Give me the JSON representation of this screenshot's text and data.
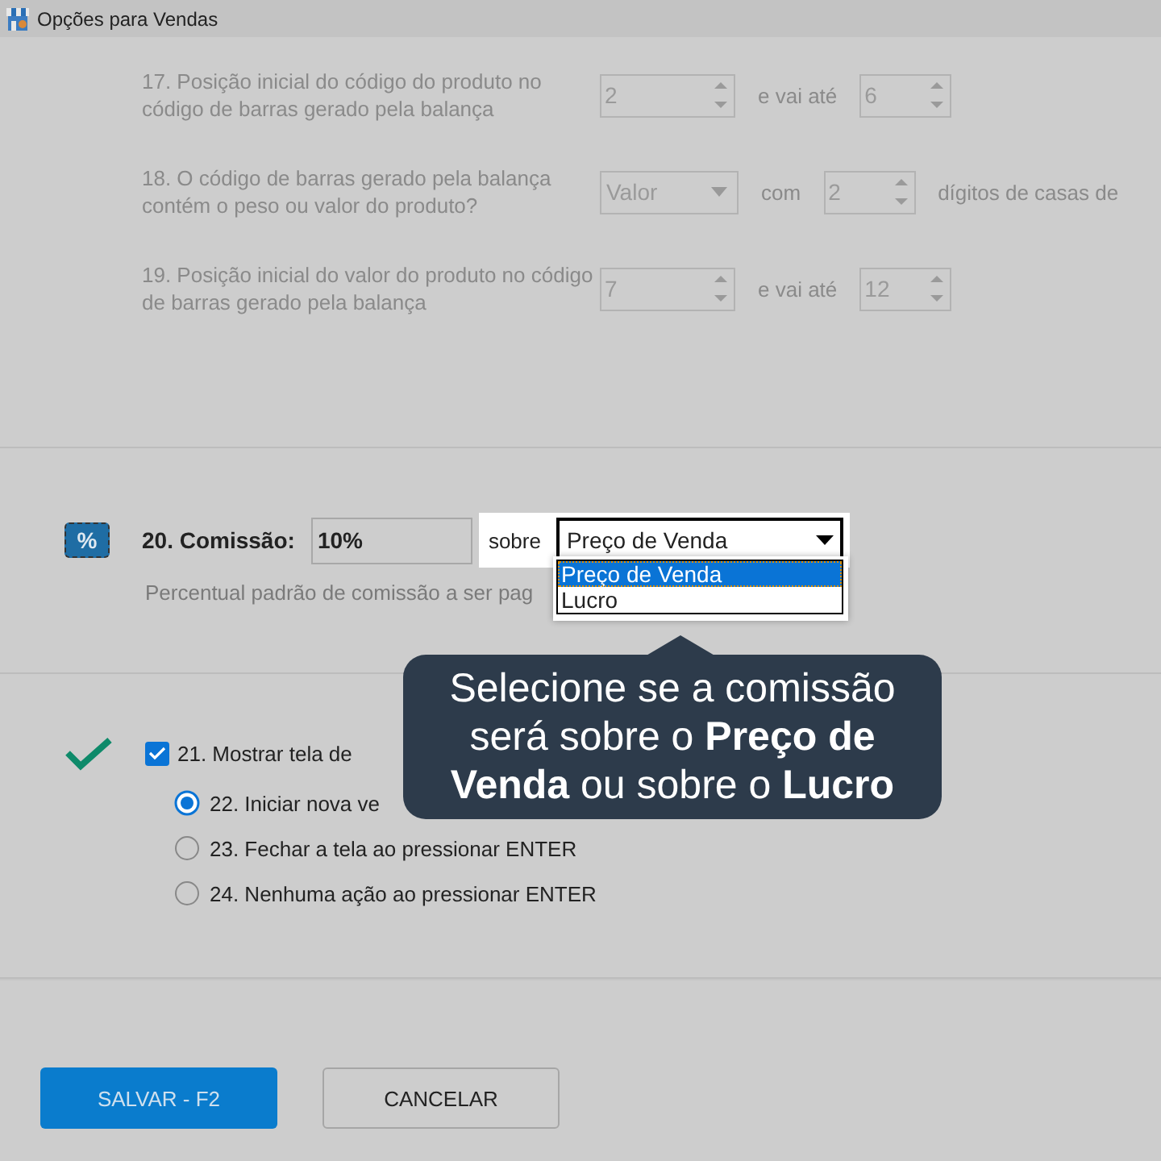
{
  "window": {
    "title": "Opções para Vendas"
  },
  "scale_rows": [
    {
      "label": "17. Posição inicial do código do produto no código de barras gerado pela balança",
      "fields": [
        {
          "kind": "spinner",
          "value": "2"
        },
        {
          "kind": "text",
          "text": "e vai até"
        },
        {
          "kind": "spinner",
          "value": "6"
        }
      ]
    },
    {
      "label": "18. O código de barras gerado pela balança contém o peso ou valor do produto?",
      "fields": [
        {
          "kind": "combo",
          "value": "Valor"
        },
        {
          "kind": "text",
          "text": "com"
        },
        {
          "kind": "spinner",
          "value": "2"
        },
        {
          "kind": "text",
          "text": "dígitos de casas de"
        }
      ]
    },
    {
      "label": "19. Posição inicial do valor do produto no código de barras gerado pela balança",
      "fields": [
        {
          "kind": "spinner",
          "value": "7"
        },
        {
          "kind": "text",
          "text": "e vai até"
        },
        {
          "kind": "spinner",
          "value": "12"
        }
      ]
    }
  ],
  "commission": {
    "label": "20. Comissão:",
    "value": "10%",
    "icon": "%",
    "sobre": "sobre",
    "basis": "Preço de Venda",
    "options": [
      {
        "label": "Preço de Venda",
        "selected": true
      },
      {
        "label": "Lucro",
        "selected": false
      }
    ],
    "hint": "Percentual padrão de comissão a ser pag"
  },
  "tooltip": "Selecione se a comissão será sobre o **Preço de Venda** ou sobre o **Lucro**",
  "show_screen": {
    "label": "21. Mostrar tela de",
    "checked": true,
    "options": [
      {
        "label": "22. Iniciar nova ve",
        "selected": true
      },
      {
        "label": "23. Fechar a tela ao pressionar ENTER",
        "selected": false
      },
      {
        "label": "24. Nenhuma ação ao pressionar ENTER",
        "selected": false
      }
    ]
  },
  "buttons": [
    {
      "label": "SALVAR - F2",
      "kind": "primary"
    },
    {
      "label": "CANCELAR",
      "kind": "secondary"
    }
  ]
}
